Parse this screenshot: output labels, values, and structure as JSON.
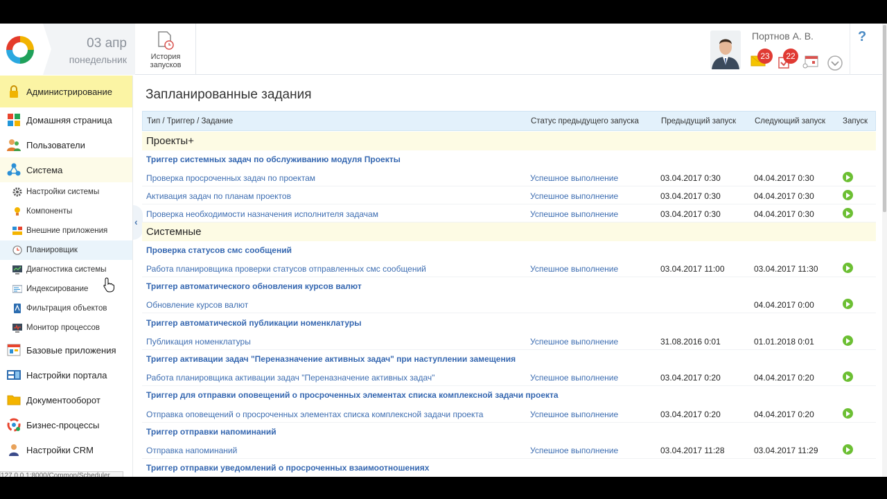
{
  "header": {
    "date_day": "03 апр",
    "date_weekday": "понедельник",
    "history_button": "История\nзапусков",
    "user_name": "Портнов А. В.",
    "messages_count": "23",
    "tasks_count": "22",
    "help": "?"
  },
  "sidebar": {
    "items": [
      {
        "label": "Администрирование",
        "icon": "lock-icon"
      },
      {
        "label": "Домашняя страница",
        "icon": "home-tiles-icon"
      },
      {
        "label": "Пользователи",
        "icon": "users-icon"
      },
      {
        "label": "Система",
        "icon": "system-icon"
      },
      {
        "label": "Настройки системы",
        "icon": "gear-icon"
      },
      {
        "label": "Компоненты",
        "icon": "components-icon"
      },
      {
        "label": "Внешние приложения",
        "icon": "external-apps-icon"
      },
      {
        "label": "Планировщик",
        "icon": "clock-icon"
      },
      {
        "label": "Диагностика системы",
        "icon": "diagnostics-icon"
      },
      {
        "label": "Индексирование",
        "icon": "index-icon"
      },
      {
        "label": "Фильтрация объектов",
        "icon": "filter-icon"
      },
      {
        "label": "Монитор процессов",
        "icon": "monitor-icon"
      },
      {
        "label": "Базовые приложения",
        "icon": "base-apps-icon"
      },
      {
        "label": "Настройки портала",
        "icon": "portal-settings-icon"
      },
      {
        "label": "Документооборот",
        "icon": "folder-icon"
      },
      {
        "label": "Бизнес-процессы",
        "icon": "business-process-icon"
      },
      {
        "label": "Настройки CRM",
        "icon": "crm-icon"
      }
    ],
    "status_url": "127.0.0.1:8000/Common/Scheduler"
  },
  "main": {
    "title": "Запланированные задания",
    "columns": {
      "type": "Тип / Триггер / Задание",
      "status": "Статус предыдущего запуска",
      "prev": "Предыдущий запуск",
      "next": "Следующий запуск",
      "run": "Запуск"
    },
    "groups": {
      "g1": "Проекты+",
      "g2": "Системные"
    },
    "triggers": {
      "t1": "Триггер системных задач по обслуживанию модуля Проекты",
      "t2": "Проверка статусов смс сообщений",
      "t3": "Триггер автоматического обновления курсов валют",
      "t4": "Триггер автоматической публикации номенклатуры",
      "t5": "Триггер активации задач \"Переназначение активных задач\" при наступлении замещения",
      "t6": "Триггер для отправки оповещений о просроченных элементах списка комплексной задачи проекта",
      "t7": "Триггер отправки напоминаний",
      "t8": "Триггер отправки уведомлений о просроченных взаимоотношениях"
    },
    "tasks": [
      {
        "name": "Проверка просроченных задач по проектам",
        "status": "Успешное выполнение",
        "prev": "03.04.2017 0:30",
        "next": "04.04.2017 0:30"
      },
      {
        "name": "Активация задач по планам проектов",
        "status": "Успешное выполнение",
        "prev": "03.04.2017 0:30",
        "next": "04.04.2017 0:30"
      },
      {
        "name": "Проверка необходимости назначения исполнителя задачам",
        "status": "Успешное выполнение",
        "prev": "03.04.2017 0:30",
        "next": "04.04.2017 0:30"
      },
      {
        "name": "Работа планировщика проверки статусов отправленных смс сообщений",
        "status": "Успешное выполнение",
        "prev": "03.04.2017 11:00",
        "next": "03.04.2017 11:30"
      },
      {
        "name": "Обновление курсов валют",
        "status": "",
        "prev": "",
        "next": "04.04.2017 0:00"
      },
      {
        "name": "Публикация номенклатуры",
        "status": "Успешное выполнение",
        "prev": "31.08.2016 0:01",
        "next": "01.01.2018 0:01"
      },
      {
        "name": "Работа планировщика активации задач \"Переназначение активных задач\"",
        "status": "Успешное выполнение",
        "prev": "03.04.2017 0:20",
        "next": "04.04.2017 0:20"
      },
      {
        "name": "Отправка оповещений о просроченных элементах списка комплексной задачи проекта",
        "status": "Успешное выполнение",
        "prev": "03.04.2017 0:20",
        "next": "04.04.2017 0:20"
      },
      {
        "name": "Отправка напоминаний",
        "status": "Успешное выполнение",
        "prev": "03.04.2017 11:28",
        "next": "03.04.2017 11:29"
      }
    ]
  }
}
